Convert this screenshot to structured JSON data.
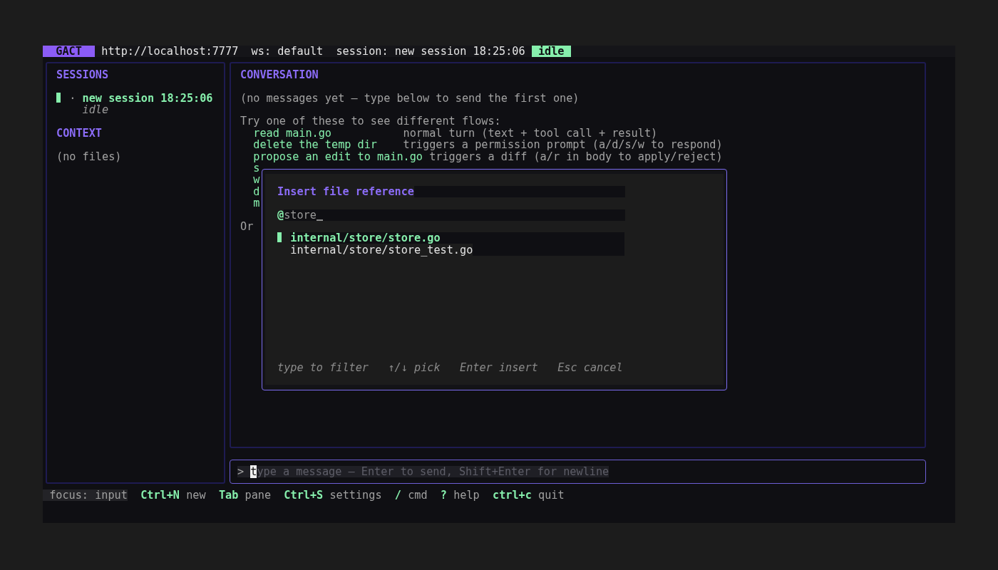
{
  "top_bar": {
    "app": "GACT",
    "url": "http://localhost:7777",
    "workspace": "ws: default",
    "session": "session: new session 18:25:06",
    "status": "idle"
  },
  "sessions": {
    "title": "SESSIONS",
    "items": [
      {
        "marker": "·",
        "name": "new session 18:25:06",
        "status": "idle",
        "selected": true
      }
    ]
  },
  "context": {
    "title": "CONTEXT",
    "empty_text": "(no files)"
  },
  "conversation": {
    "title": "CONVERSATION",
    "empty_text": "(no messages yet — type below to send the first one)",
    "hint_heading": "Try one of these to see different flows:",
    "suggestions": [
      {
        "command": "read main.go",
        "description": "normal turn (text + tool call + result)"
      },
      {
        "command": "delete the temp dir",
        "description": "triggers a permission prompt (a/d/s/w to respond)"
      },
      {
        "command": "propose an edit to main.go",
        "description": "triggers a diff (a/r in body to apply/reject)"
      },
      {
        "command": "s"
      },
      {
        "command": "w"
      },
      {
        "command": "d"
      },
      {
        "command": "m"
      }
    ],
    "footer": "Or"
  },
  "file_picker": {
    "title": "Insert file reference",
    "query_prefix": "@",
    "query": "store",
    "files": [
      {
        "path": "internal/store/store.go",
        "selected": true
      },
      {
        "path": "internal/store/store_test.go",
        "selected": false
      }
    ],
    "hints": [
      "type to filter",
      "↑/↓ pick",
      "Enter insert",
      "Esc cancel"
    ]
  },
  "input": {
    "prompt": ">",
    "placeholder": "type a message — Enter to send, Shift+Enter for newline"
  },
  "status_bar": {
    "focus": "focus: input",
    "shortcuts": [
      {
        "key": "Ctrl+N",
        "label": "new"
      },
      {
        "key": "Tab",
        "label": "pane"
      },
      {
        "key": "Ctrl+S",
        "label": "settings"
      },
      {
        "key": "/",
        "label": "cmd"
      },
      {
        "key": "?",
        "label": "help"
      },
      {
        "key": "ctrl+c",
        "label": "quit"
      }
    ]
  }
}
